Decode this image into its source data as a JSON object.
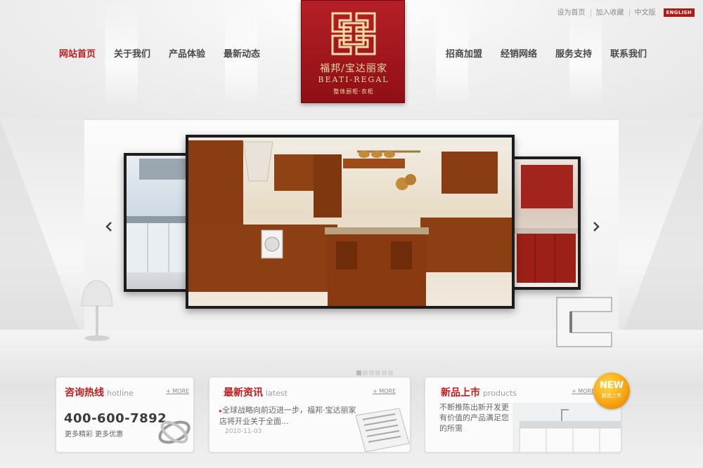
{
  "top_links": {
    "set_home": "设为首页",
    "favorite": "加入收藏",
    "chinese": "中文版",
    "english": "ENGLISH"
  },
  "nav": {
    "left": [
      "网站首页",
      "关于我们",
      "产品体验",
      "最新动态"
    ],
    "right": [
      "招商加盟",
      "经销网络",
      "服务支持",
      "联系我们"
    ]
  },
  "logo": {
    "name_cn": "福邦/宝达丽家",
    "name_en": "BEATI-REGAL",
    "tagline": "整体厨柜·衣柜"
  },
  "slider": {
    "prev_icon": "chevron-left-icon",
    "next_icon": "chevron-right-icon",
    "active_dot": 0,
    "dot_count": 6
  },
  "hotline": {
    "title": "咨询热线",
    "title_en": "hotline",
    "more": "+ MORE",
    "number": "400-600-7892",
    "slogan": "更多精彩  更多优惠"
  },
  "news": {
    "title": "最新资讯",
    "title_en": "latest",
    "more": "+ MORE",
    "item_text": "全球战略向前迈进一步，福邦·宝达丽家店将开业关于全面...",
    "item_date": "2010-11-03"
  },
  "products": {
    "title": "新品上市",
    "title_en": "products",
    "more": "+ MORE",
    "description": "不断推陈出新开发更有价值的产品满足您的所需",
    "badge": "NEW",
    "badge_sub": "新品上市"
  },
  "colors": {
    "accent": "#c11b1b",
    "logo_bg": "#a3171d",
    "logo_text": "#f2dca6"
  }
}
